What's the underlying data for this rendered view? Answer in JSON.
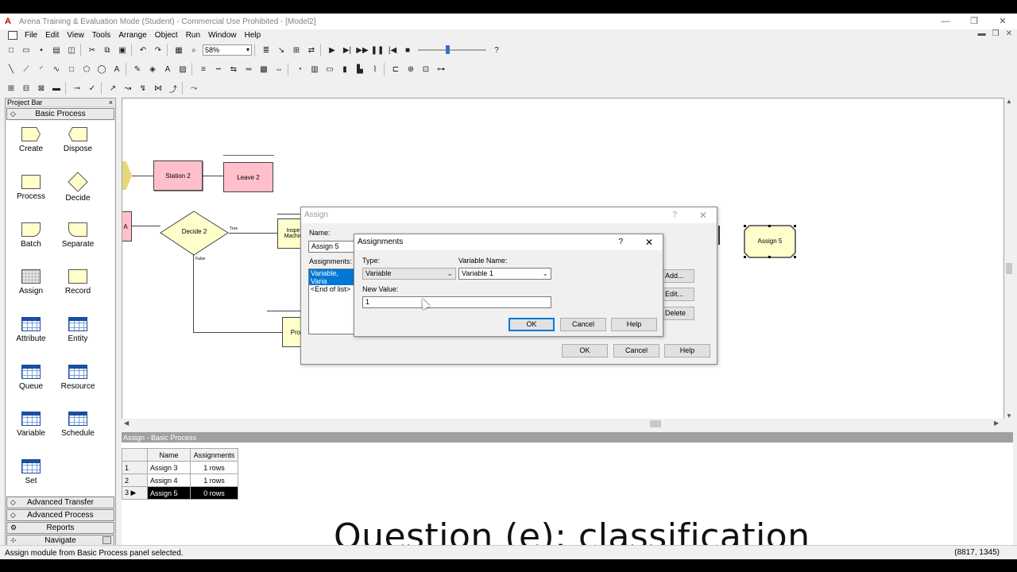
{
  "window": {
    "title": "Arena Training & Evaluation Mode (Student) - Commercial Use Prohibited - [Model2]",
    "minimize": "—",
    "restore": "❐",
    "close": "✕"
  },
  "menu": [
    "File",
    "Edit",
    "View",
    "Tools",
    "Arrange",
    "Object",
    "Run",
    "Window",
    "Help"
  ],
  "toolbar": {
    "zoom": "58%"
  },
  "project_bar": {
    "title": "Project Bar",
    "close": "×",
    "basic_process_label": "Basic Process",
    "modules": [
      {
        "label": "Create",
        "icon": "create-module-icon"
      },
      {
        "label": "Dispose",
        "icon": "dispose-module-icon"
      },
      {
        "label": "Process",
        "icon": "process-module-icon"
      },
      {
        "label": "Decide",
        "icon": "decide-module-icon"
      },
      {
        "label": "Batch",
        "icon": "batch-module-icon"
      },
      {
        "label": "Separate",
        "icon": "separate-module-icon"
      },
      {
        "label": "Assign",
        "icon": "assign-module-icon"
      },
      {
        "label": "Record",
        "icon": "record-module-icon"
      },
      {
        "label": "Attribute",
        "icon": "attribute-table-icon"
      },
      {
        "label": "Entity",
        "icon": "entity-table-icon"
      },
      {
        "label": "Queue",
        "icon": "queue-table-icon"
      },
      {
        "label": "Resource",
        "icon": "resource-table-icon"
      },
      {
        "label": "Variable",
        "icon": "variable-table-icon"
      },
      {
        "label": "Schedule",
        "icon": "schedule-table-icon"
      },
      {
        "label": "Set",
        "icon": "set-table-icon"
      }
    ],
    "panels": [
      "Advanced Transfer",
      "Advanced Process",
      "Reports",
      "Navigate"
    ]
  },
  "canvas": {
    "blocks": {
      "station2": "Station 2",
      "leave2": "Leave 2",
      "decide2": "Decide 2",
      "inspect": "Inspe Machin",
      "assign5": "Assign 5",
      "partial_a": "A",
      "pro": "Pro",
      "true_label": "True",
      "false_label": "False"
    }
  },
  "spreadsheet": {
    "title": "Assign - Basic Process",
    "headers": [
      "Name",
      "Assignments"
    ],
    "rows": [
      {
        "num": "1",
        "name": "Assign 3",
        "assignments": "1 rows"
      },
      {
        "num": "2",
        "name": "Assign 4",
        "assignments": "1 rows"
      },
      {
        "num": "3",
        "name": "Assign 5",
        "assignments": "0 rows"
      }
    ]
  },
  "assign_dialog": {
    "title": "Assign",
    "help": "?",
    "close": "✕",
    "name_label": "Name:",
    "name_value": "Assign 5",
    "assignments_label": "Assignments:",
    "list": [
      "Variable, Varia",
      "<End of list>"
    ],
    "add": "Add...",
    "edit": "Edit...",
    "delete": "Delete",
    "ok": "OK",
    "cancel": "Cancel",
    "help_btn": "Help"
  },
  "assignments_dialog": {
    "title": "Assignments",
    "help": "?",
    "close": "✕",
    "type_label": "Type:",
    "type_value": "Variable",
    "variable_name_label": "Variable Name:",
    "variable_name_value": "Variable 1",
    "new_value_label": "New Value:",
    "new_value": "1",
    "ok": "OK",
    "cancel": "Cancel",
    "help_btn": "Help"
  },
  "caption": "Question (e): classification",
  "status": {
    "message": "Assign module from Basic Process panel selected.",
    "coords": "(8817, 1345)"
  }
}
